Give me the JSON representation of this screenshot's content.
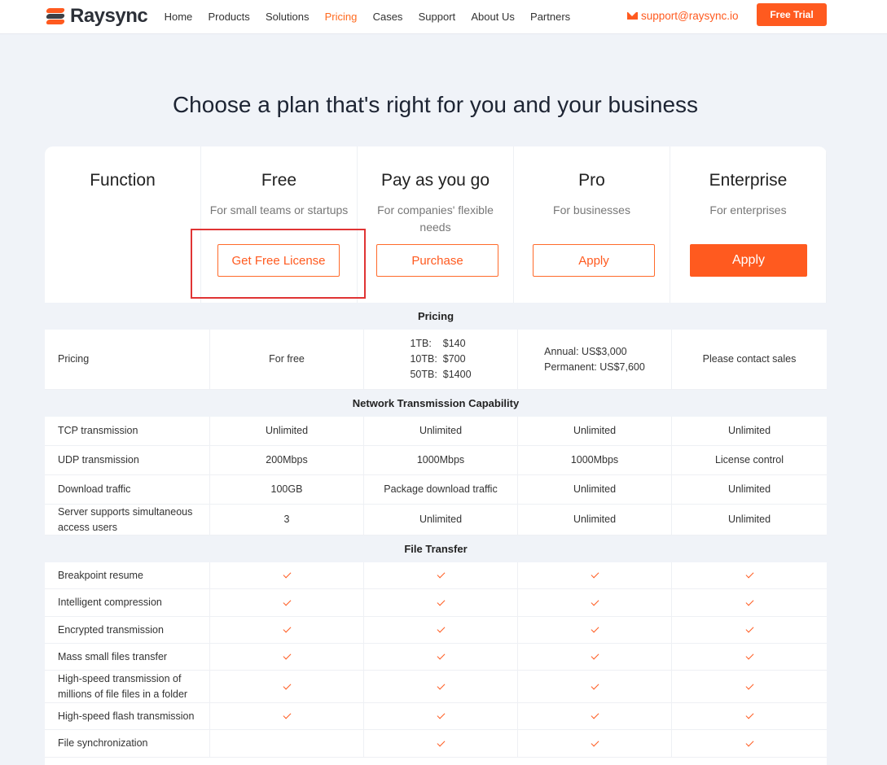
{
  "brand": {
    "name": "Raysync"
  },
  "nav": {
    "items": [
      "Home",
      "Products",
      "Solutions",
      "Pricing",
      "Cases",
      "Support",
      "About Us",
      "Partners"
    ],
    "active": "Pricing",
    "email": "support@raysync.io",
    "cta": "Free Trial"
  },
  "colors": {
    "accent": "#ff5a1f",
    "section_bg": "#f0f3f8",
    "highlight_box": "#e03434"
  },
  "title": "Choose a plan that's right for you and your business",
  "function_header": "Function",
  "plans": [
    {
      "name": "Free",
      "desc": "For small teams or startups",
      "button": "Get Free License"
    },
    {
      "name": "Pay as you go",
      "desc": "For companies' flexible needs",
      "button": "Purchase"
    },
    {
      "name": "Pro",
      "desc": "For businesses",
      "button": "Apply"
    },
    {
      "name": "Enterprise",
      "desc": "For enterprises",
      "button": "Apply"
    }
  ],
  "sections": {
    "pricing": "Pricing",
    "network": "Network Transmission Capability",
    "file": "File Transfer"
  },
  "pricing_row": {
    "label": "Pricing",
    "free": "For free",
    "payg": [
      "1TB:    $140",
      "10TB:  $700",
      "50TB:  $1400"
    ],
    "pro": [
      "Annual: US$3,000",
      "Permanent: US$7,600"
    ],
    "enterprise": "Please contact sales"
  },
  "network_rows": [
    {
      "label": "TCP transmission",
      "values": [
        "Unlimited",
        "Unlimited",
        "Unlimited",
        "Unlimited"
      ]
    },
    {
      "label": "UDP transmission",
      "values": [
        "200Mbps",
        "1000Mbps",
        "1000Mbps",
        "License control"
      ]
    },
    {
      "label": "Download traffic",
      "values": [
        "100GB",
        "Package download traffic",
        "Unlimited",
        "Unlimited"
      ]
    },
    {
      "label": "Server supports simultaneous access users",
      "values": [
        "3",
        "Unlimited",
        "Unlimited",
        "Unlimited"
      ]
    }
  ],
  "file_rows": [
    {
      "label": "Breakpoint resume",
      "checks": [
        true,
        true,
        true,
        true
      ]
    },
    {
      "label": "Intelligent compression",
      "checks": [
        true,
        true,
        true,
        true
      ]
    },
    {
      "label": "Encrypted transmission",
      "checks": [
        true,
        true,
        true,
        true
      ]
    },
    {
      "label": "Mass small files transfer",
      "checks": [
        true,
        true,
        true,
        true
      ]
    },
    {
      "label": "High-speed transmission of millions of file files in a folder",
      "checks": [
        true,
        true,
        true,
        true
      ]
    },
    {
      "label": "High-speed flash transmission",
      "checks": [
        true,
        true,
        true,
        true
      ]
    },
    {
      "label": "File synchronization",
      "checks": [
        false,
        true,
        true,
        true
      ]
    }
  ]
}
